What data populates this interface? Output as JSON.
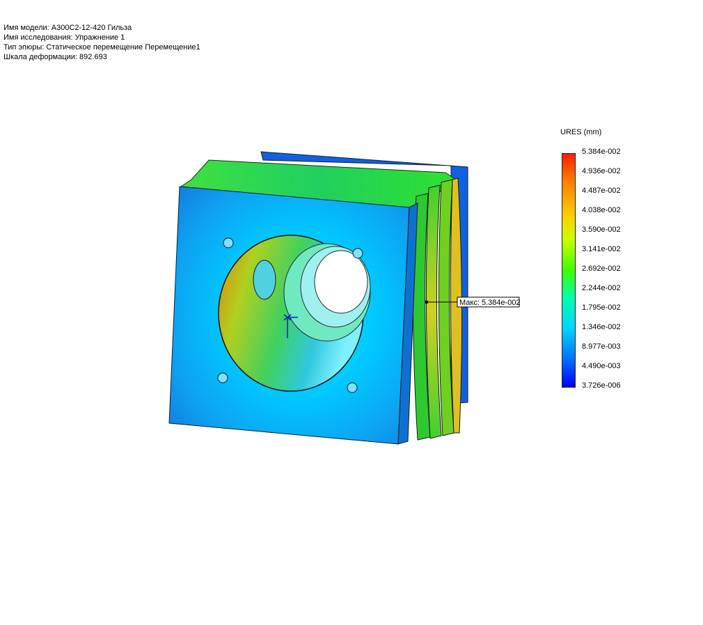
{
  "info": {
    "model": "Имя модели: А300С2-12-420 Гильза",
    "study": "Имя  исследования: Упражнение 1",
    "plot_type": "Тип эпюры: Статическое перемещение Перемещение1",
    "deform_scale": "Шкала деформации: 892.693"
  },
  "legend": {
    "title": "URES (mm)",
    "ticks": [
      "5.384e-002",
      "4.936e-002",
      "4.487e-002",
      "4.038e-002",
      "3.590e-002",
      "3.141e-002",
      "2.692e-002",
      "2.244e-002",
      "1.795e-002",
      "1.346e-002",
      "8.977e-003",
      "4.490e-003",
      "3.726e-006"
    ]
  },
  "annotation": {
    "max_label": "Макс: 5.384e-002"
  }
}
